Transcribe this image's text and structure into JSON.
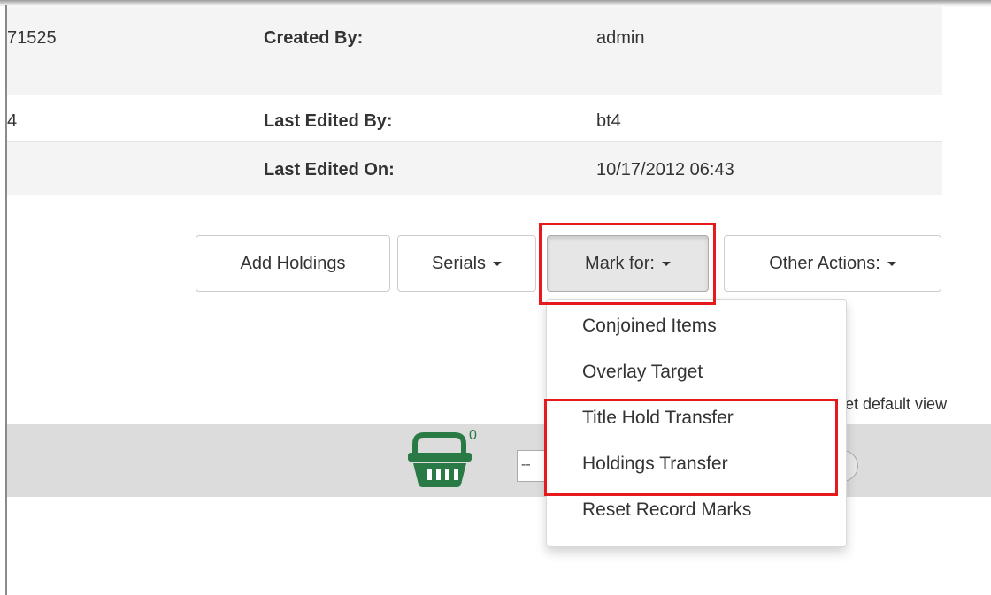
{
  "record_info": {
    "rows": [
      {
        "col1": "71525",
        "label": "Created By:",
        "value": "admin"
      },
      {
        "col1": "4",
        "label": "Last Edited By:",
        "value": "bt4"
      },
      {
        "col1": "",
        "label": "Last Edited On:",
        "value": "10/17/2012 06:43"
      }
    ]
  },
  "actions": {
    "add_holdings": "Add Holdings",
    "serials": "Serials",
    "mark_for": "Mark for:",
    "other_actions": "Other Actions:"
  },
  "mark_for_menu": {
    "items": [
      "Conjoined Items",
      "Overlay Target",
      "Title Hold Transfer",
      "Holdings Transfer",
      "Reset Record Marks"
    ]
  },
  "view": {
    "default_view_text": "et default view"
  },
  "basket": {
    "count": "0",
    "icon": "basket-icon",
    "color": "#2a7a45"
  },
  "select_stub": {
    "text": "--"
  },
  "highlight_color": "#e41a1c"
}
